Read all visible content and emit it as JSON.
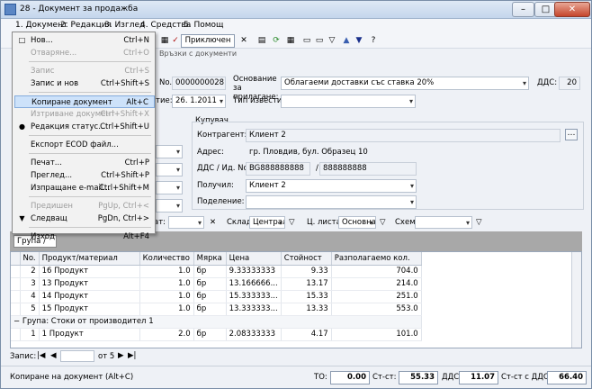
{
  "window": {
    "title": "28 - Документ за продажба"
  },
  "menubar": [
    "1. Документ",
    "2. Редакция",
    "3. Изглед",
    "4. Средства",
    "5. Помощ"
  ],
  "toolbar": {
    "primary_label": "Приключен"
  },
  "tabs": [
    "Връзки с документи"
  ],
  "header": {
    "doc_no_label": "No.",
    "doc_no": "0000000028",
    "date_label": "тие:",
    "date": "26. 1.2011",
    "basis_label": "Основание за прилагане:",
    "basis_value": "Облагаеми доставки със ставка 20%",
    "vat_label": "ДДС:",
    "vat_value": "20",
    "notice_label": "Тип известие:"
  },
  "buyer": {
    "section_label": "Купувач",
    "contractor_label": "Контрагент:",
    "contractor_value": "Клиент 2",
    "address_label": "Адрес:",
    "address_value": "гр. Пловдив, бул. Образец 10",
    "vat_id_label": "ДДС / Ид. No.",
    "vat_no": "BG888888888",
    "sep": "/",
    "id_no": "888888888",
    "received_label": "Получил:",
    "received_value": "Клиент 2",
    "division_label": "Поделение:"
  },
  "filterbar": {
    "at_label": "ат:",
    "warehouse_label": "Склад",
    "warehouse_value": "Централ",
    "pricelist_label": "Ц. листа",
    "pricelist_value": "Основна",
    "scheme_label": "Схема"
  },
  "group_chip": "Група /",
  "grid": {
    "columns": [
      "No.",
      "Продукт/материал",
      "Количество",
      "Мярка",
      "Цена",
      "Стойност",
      "Разполагаемо кол."
    ],
    "rows": [
      [
        "2",
        "16 Продукт",
        "1.0",
        "бр",
        "9.33333333",
        "9.33",
        "704.0"
      ],
      [
        "3",
        "13 Продукт",
        "1.0",
        "бр",
        "13.166666...",
        "13.17",
        "214.0"
      ],
      [
        "4",
        "14 Продукт",
        "1.0",
        "бр",
        "15.333333...",
        "15.33",
        "251.0"
      ],
      [
        "5",
        "15 Продукт",
        "1.0",
        "бр",
        "13.333333...",
        "13.33",
        "553.0"
      ]
    ],
    "group_row": "Група: Стоки от производител 1",
    "rows2": [
      [
        "1",
        "1 Продукт",
        "2.0",
        "бр",
        "2.08333333",
        "4.17",
        "101.0"
      ]
    ]
  },
  "nav": {
    "label": "Запис:",
    "of": "от 5"
  },
  "status": {
    "message": "Копиране на документ (Alt+C)",
    "to_label": "ТО:",
    "to_value": "0.00",
    "st_label": "Ст-ст:",
    "st_value": "55.33",
    "vat_label": "ДДС:",
    "vat_value": "11.07",
    "stvat_label": "Ст-ст с ДДС:",
    "stvat_value": "66.40"
  },
  "menu": [
    {
      "icon": "□",
      "label": "Нов...",
      "key": "Ctrl+N",
      "disabled": false
    },
    {
      "icon": "",
      "label": "Отваряне...",
      "key": "Ctrl+O",
      "disabled": true
    },
    {
      "sep": true
    },
    {
      "icon": "",
      "label": "Запис",
      "key": "Ctrl+S",
      "disabled": true
    },
    {
      "icon": "",
      "label": "Запис и нов",
      "key": "Ctrl+Shift+S",
      "disabled": false
    },
    {
      "sep": true
    },
    {
      "icon": "",
      "label": "Копиране документ",
      "key": "Alt+C",
      "disabled": false,
      "selected": true
    },
    {
      "icon": "",
      "label": "Изтриване документ",
      "key": "Ctrl+Shift+X",
      "disabled": true
    },
    {
      "icon": "●",
      "label": "Редакция статус...",
      "key": "Ctrl+Shift+U",
      "disabled": false
    },
    {
      "sep": true
    },
    {
      "icon": "",
      "label": "Експорт ECOD файл...",
      "key": "",
      "disabled": false
    },
    {
      "sep": true
    },
    {
      "icon": "",
      "label": "Печат...",
      "key": "Ctrl+P",
      "disabled": false
    },
    {
      "icon": "",
      "label": "Преглед...",
      "key": "Ctrl+Shift+P",
      "disabled": false
    },
    {
      "icon": "",
      "label": "Изпращане e-mail...",
      "key": "Ctrl+Shift+M",
      "disabled": false
    },
    {
      "sep": true
    },
    {
      "icon": "",
      "label": "Предишен",
      "key": "PgUp, Ctrl+<",
      "disabled": true
    },
    {
      "icon": "▼",
      "label": "Следващ",
      "key": "PgDn, Ctrl+>",
      "disabled": false
    },
    {
      "sep": true
    },
    {
      "icon": "",
      "label": "Изход",
      "key": "Alt+F4",
      "disabled": false
    }
  ]
}
